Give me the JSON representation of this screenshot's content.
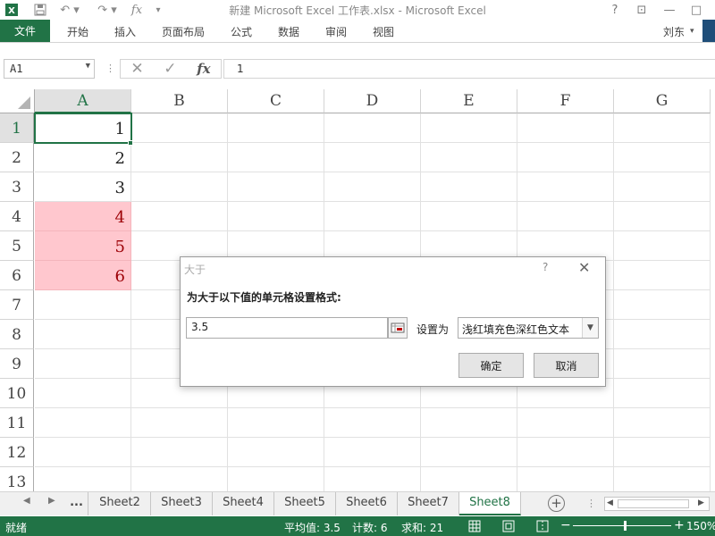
{
  "titlebar": {
    "title": "新建 Microsoft Excel 工作表.xlsx - Microsoft Excel",
    "help": "?",
    "restore": "⊡",
    "minimize": "—",
    "maximize": "□"
  },
  "ribbon": {
    "file_label": "文件",
    "tabs": [
      "开始",
      "插入",
      "页面布局",
      "公式",
      "数据",
      "审阅",
      "视图"
    ],
    "user": "刘东"
  },
  "formula_bar": {
    "name_box": "A1",
    "fx": "fx",
    "value": "1"
  },
  "grid": {
    "columns": [
      "A",
      "B",
      "C",
      "D",
      "E",
      "F",
      "G"
    ],
    "rows": [
      "1",
      "2",
      "3",
      "4",
      "5",
      "6",
      "7",
      "8",
      "9",
      "10",
      "11",
      "12",
      "13"
    ],
    "column_a_values": [
      "1",
      "2",
      "3",
      "4",
      "5",
      "6"
    ],
    "highlight_fill": "#ffc7ce",
    "highlight_text": "#9c0006"
  },
  "sheets": {
    "ellipsis": "...",
    "tabs": [
      "Sheet2",
      "Sheet3",
      "Sheet4",
      "Sheet5",
      "Sheet6",
      "Sheet7",
      "Sheet8"
    ],
    "active": "Sheet8"
  },
  "statusbar": {
    "ready": "就绪",
    "average": "平均值: 3.5",
    "count": "计数: 6",
    "sum": "求和: 21",
    "zoom_minus": "−",
    "zoom_plus": "+",
    "zoom": "150%"
  },
  "dialog": {
    "title": "大于",
    "help": "?",
    "close": "✕",
    "prompt": "为大于以下值的单元格设置格式:",
    "value": "3.5",
    "set_label": "设置为",
    "format_option": "浅红填充色深红色文本",
    "ok": "确定",
    "cancel": "取消"
  },
  "colors": {
    "excel_green": "#217346"
  }
}
